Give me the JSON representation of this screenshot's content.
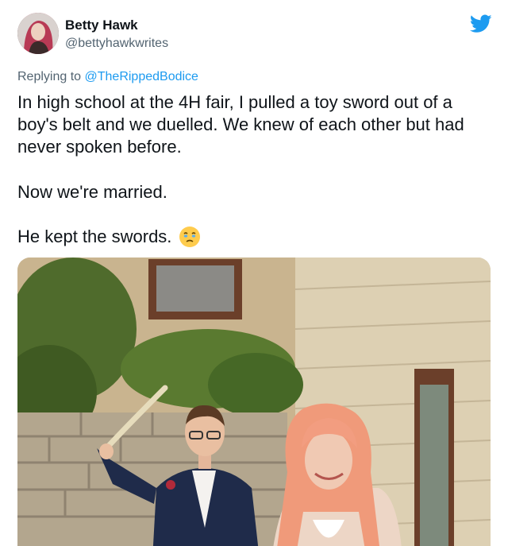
{
  "author": {
    "display_name": "Betty Hawk",
    "handle": "@bettyhawkwrites"
  },
  "icons": {
    "avatar": "avatar",
    "platform": "twitter-bird-icon",
    "emoji": "face-holding-back-tears-emoji"
  },
  "colors": {
    "brand": "#1d9bf0",
    "text": "#0f1419",
    "secondary": "#536471"
  },
  "reply": {
    "prefix": "Replying to",
    "mention": "@TheRippedBodice"
  },
  "tweet": {
    "paragraph1": "In high school at the 4H fair, I pulled a toy sword out of a boy's belt and we duelled. We knew of each other but had never spoken before.",
    "paragraph2": "Now we're married.",
    "paragraph3": "He kept the swords."
  }
}
